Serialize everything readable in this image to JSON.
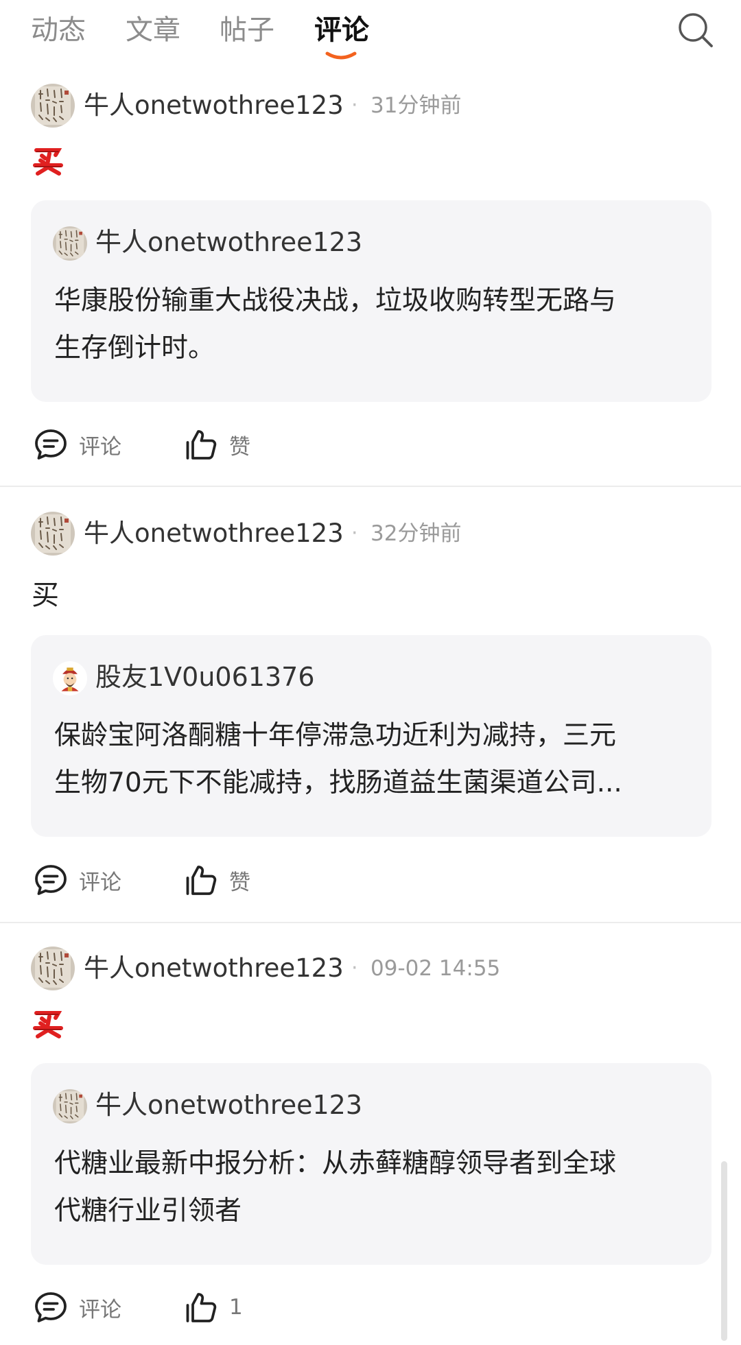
{
  "tabs": [
    {
      "label": "动态"
    },
    {
      "label": "文章"
    },
    {
      "label": "帖子"
    },
    {
      "label": "评论"
    }
  ],
  "active_tab": "评论",
  "colors": {
    "accent": "#f3621e",
    "buy_red": "#e02020",
    "quote_bg": "#f5f5f7"
  },
  "icons": {
    "search": "search-icon",
    "comment": "comment-icon",
    "like": "thumbs-up-icon",
    "buy": "buy-emoji-icon"
  },
  "comments": [
    {
      "author": "牛人onetwothree123",
      "time": "31分钟前",
      "body": "",
      "body_emoji": "买",
      "quote": {
        "author": "牛人onetwothree123",
        "lines": [
          "华康股份输重大战役决战，垃圾收购转型无路与",
          "生存倒计时。"
        ]
      },
      "comment_label": "评论",
      "like_label": "赞"
    },
    {
      "author": "牛人onetwothree123",
      "time": "32分钟前",
      "body": "买",
      "quote": {
        "author": "股友1V0u061376",
        "lines": [
          "保龄宝阿洛酮糖十年停滞急功近利为减持，三元",
          "生物70元下不能减持，找肠道益生菌渠道公司..."
        ]
      },
      "comment_label": "评论",
      "like_label": "赞"
    },
    {
      "author": "牛人onetwothree123",
      "time": "09-02 14:55",
      "body": "",
      "body_emoji": "买",
      "quote": {
        "author": "牛人onetwothree123",
        "lines": [
          "代糖业最新中报分析：从赤藓糖醇领导者到全球",
          "代糖行业引领者"
        ]
      },
      "comment_label": "评论",
      "like_label": "1"
    }
  ]
}
